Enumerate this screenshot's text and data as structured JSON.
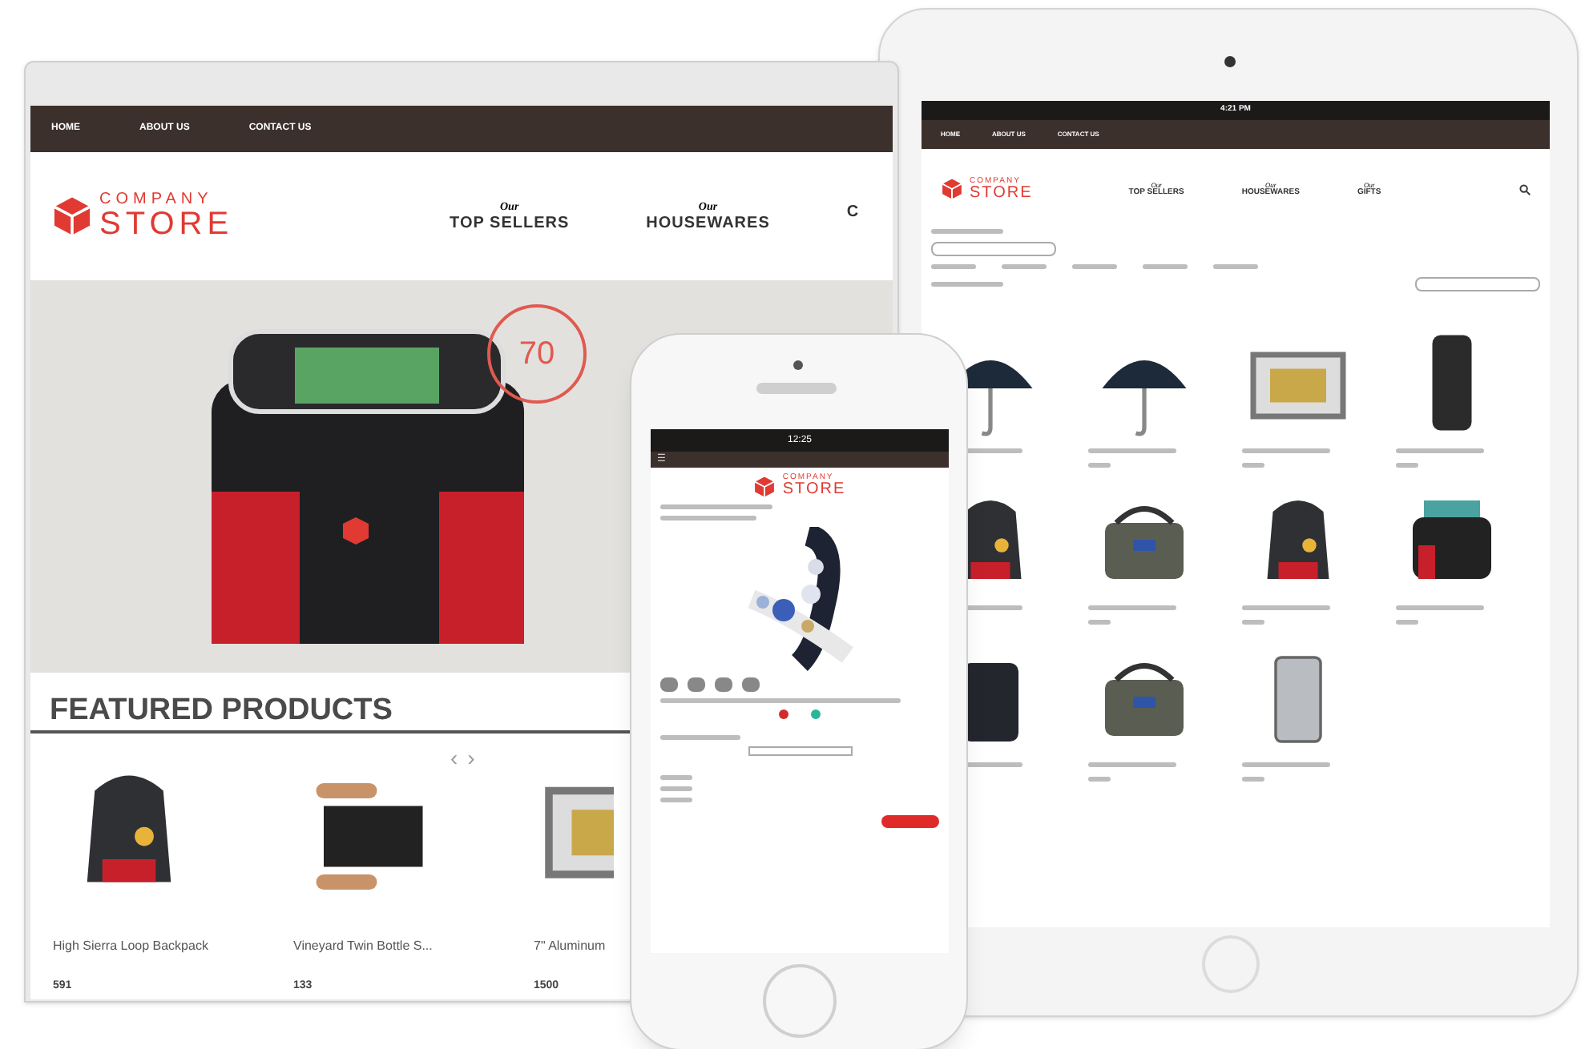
{
  "laptop": {
    "top_nav": [
      {
        "label": "HOME"
      },
      {
        "label": "ABOUT US"
      },
      {
        "label": "CONTACT US"
      }
    ],
    "logo": {
      "line1": "COMPANY",
      "line2": "STORE"
    },
    "menu": [
      {
        "over": "Our",
        "label": "TOP SELLERS"
      },
      {
        "over": "Our",
        "label": "HOUSEWARES"
      },
      {
        "label": "C"
      }
    ],
    "hero": {
      "badge": "70"
    },
    "featured": {
      "title": "FEATURED PRODUCTS",
      "arrows": [
        "‹",
        "›"
      ],
      "products": [
        {
          "kind": "backpack",
          "name": "High Sierra Loop Backpack",
          "price": "591"
        },
        {
          "kind": "wine-box",
          "name": "Vineyard Twin Bottle S...",
          "price": "133"
        },
        {
          "kind": "frame",
          "name": "7\" Aluminum",
          "price": "1500"
        }
      ]
    }
  },
  "tablet": {
    "status_time": "4:21 PM",
    "top_nav": [
      {
        "label": "HOME"
      },
      {
        "label": "ABOUT US"
      },
      {
        "label": "CONTACT US"
      }
    ],
    "logo": {
      "line1": "COMPANY",
      "line2": "STORE"
    },
    "menu": [
      {
        "over": "Our",
        "label": "TOP SELLERS"
      },
      {
        "over": "Our",
        "label": "HOUSEWARES"
      },
      {
        "over": "Our",
        "label": "GIFTS"
      }
    ],
    "products": [
      {
        "kind": "umbrella"
      },
      {
        "kind": "umbrella"
      },
      {
        "kind": "frame"
      },
      {
        "kind": "bottle"
      },
      {
        "kind": "backpack"
      },
      {
        "kind": "bag"
      },
      {
        "kind": "backpack"
      },
      {
        "kind": "cooler"
      },
      {
        "kind": "luggage"
      },
      {
        "kind": "bag"
      },
      {
        "kind": "lighter"
      }
    ]
  },
  "phone": {
    "status_time": "12:25",
    "logo": {
      "line1": "COMPANY",
      "line2": "STORE"
    },
    "menu_icon": "☰"
  }
}
